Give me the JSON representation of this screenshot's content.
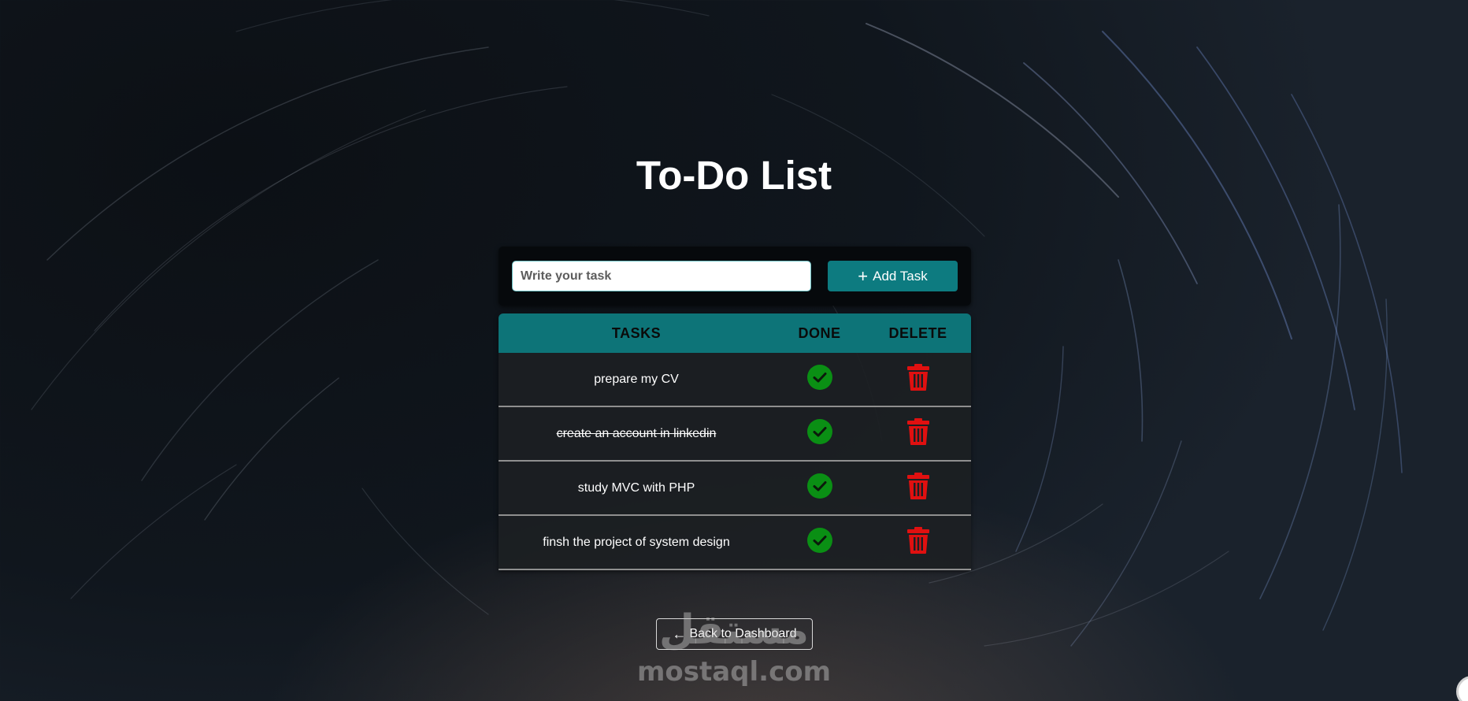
{
  "page": {
    "title": "To-Do List",
    "accent_color": "#0d7b80",
    "done_color": "#0a8f14",
    "delete_color": "#e01010"
  },
  "add_form": {
    "placeholder": "Write your task",
    "value": "",
    "button_label": "Add Task",
    "button_icon": "plus-icon"
  },
  "table": {
    "headers": {
      "tasks": "TASKS",
      "done": "DONE",
      "delete": "DELETE"
    },
    "rows": [
      {
        "task": "prepare my CV",
        "completed": false
      },
      {
        "task": "create an account in linkedin",
        "completed": true
      },
      {
        "task": "study MVC with PHP",
        "completed": false
      },
      {
        "task": "finsh the project of system design",
        "completed": false
      }
    ],
    "done_icon": "check-circle-icon",
    "delete_icon": "trash-icon"
  },
  "footer": {
    "back_label": "Back to Dashboard",
    "back_icon": "arrow-left-icon"
  },
  "watermark": {
    "arabic": "مستقل",
    "latin": "mostaql.com"
  }
}
